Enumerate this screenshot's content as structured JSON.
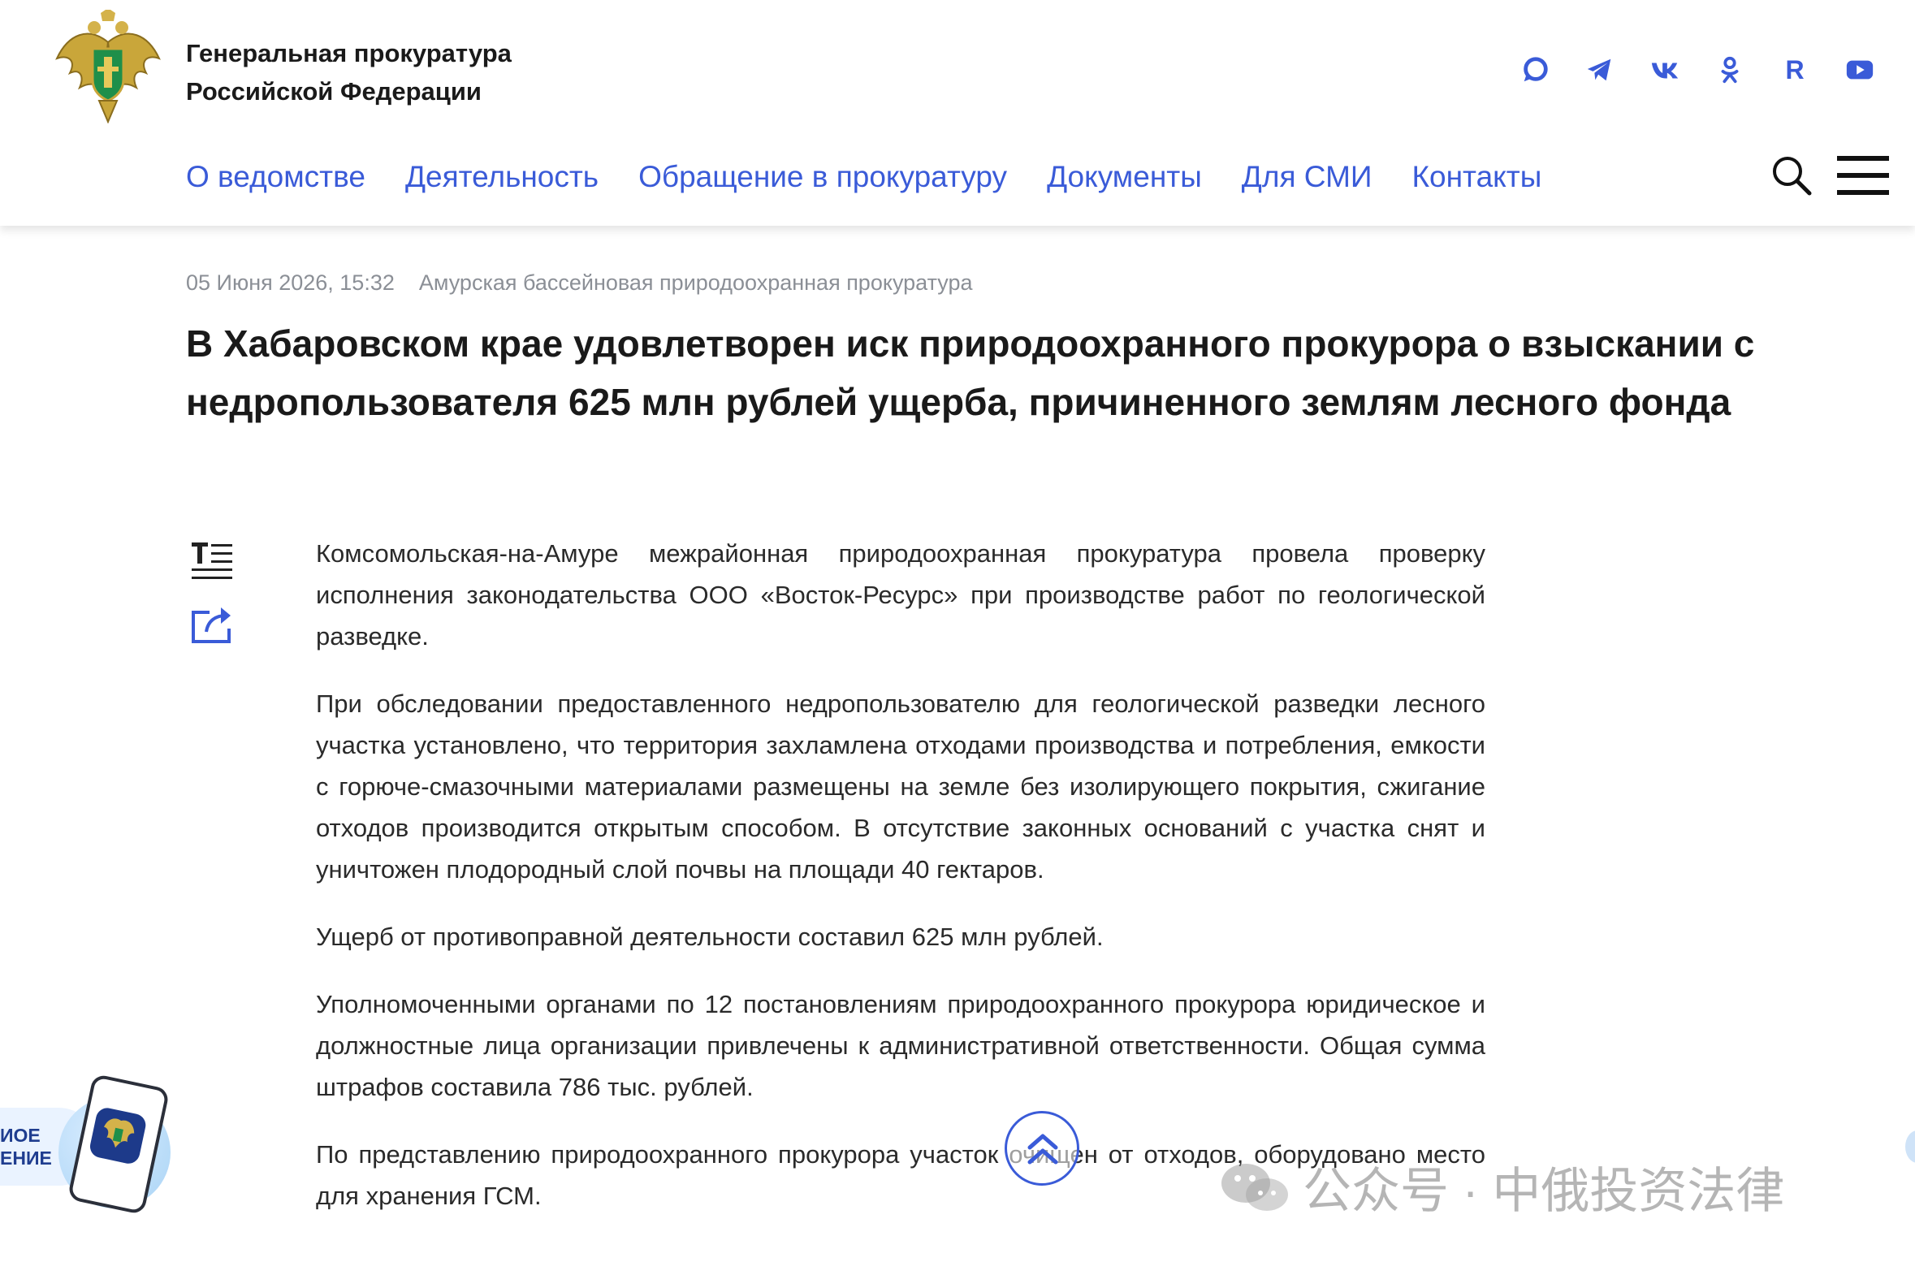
{
  "header": {
    "org_line1": "Генеральная прокуратура",
    "org_line2": "Российской Федерации",
    "social": [
      "max-icon",
      "telegram-icon",
      "vk-icon",
      "ok-icon",
      "rutube-icon",
      "youtube-icon"
    ],
    "rutube_letter": "R",
    "nav": [
      "О ведомстве",
      "Деятельность",
      "Обращение в прокуратуру",
      "Документы",
      "Для СМИ",
      "Контакты"
    ]
  },
  "article": {
    "date": "05 Июня 2026, 15:32",
    "source": "Амурская бассейновая природоохранная прокуратура",
    "title": "В Хабаровском крае удовлетворен иск природоохранного прокурора о взыскании с недропользователя 625 млн рублей ущерба, причиненного землям лесного фонда",
    "paragraphs": [
      "Комсомольская-на-Амуре межрайонная природоохранная прокуратура провела проверку исполнения законодательства ООО «Восток-Ресурс» при производстве работ по геологической разведке.",
      "При обследовании предоставленного недропользователю для геологической разведки лесного участка установлено, что территория захламлена отходами производства и потребления, емкости с горюче-смазочными материалами размещены на земле без изолирующего покрытия, сжигание отходов производится открытым способом. В отсутствие законных оснований с участка снят и уничтожен плодородный слой почвы на площади 40 гектаров.",
      "Ущерб от противоправной деятельности составил 625 млн рублей.",
      "Уполномоченными органами по 12 постановлениям природоохранного прокурора юридическое и должностные лица организации привлечены к административной ответственности. Общая сумма штрафов составила 786 тыс. рублей.",
      "По представлению природоохранного прокурора участок очищен от отходов, оборудовано место для хранения ГСМ."
    ]
  },
  "promo": {
    "line1": "ИОЕ",
    "line2": "ЕНИЕ"
  },
  "watermark": {
    "text": "公众号 · 中俄投资法律"
  },
  "colors": {
    "accent": "#3a5bd8",
    "meta": "#8b8f96",
    "title": "#1a1a1a"
  }
}
